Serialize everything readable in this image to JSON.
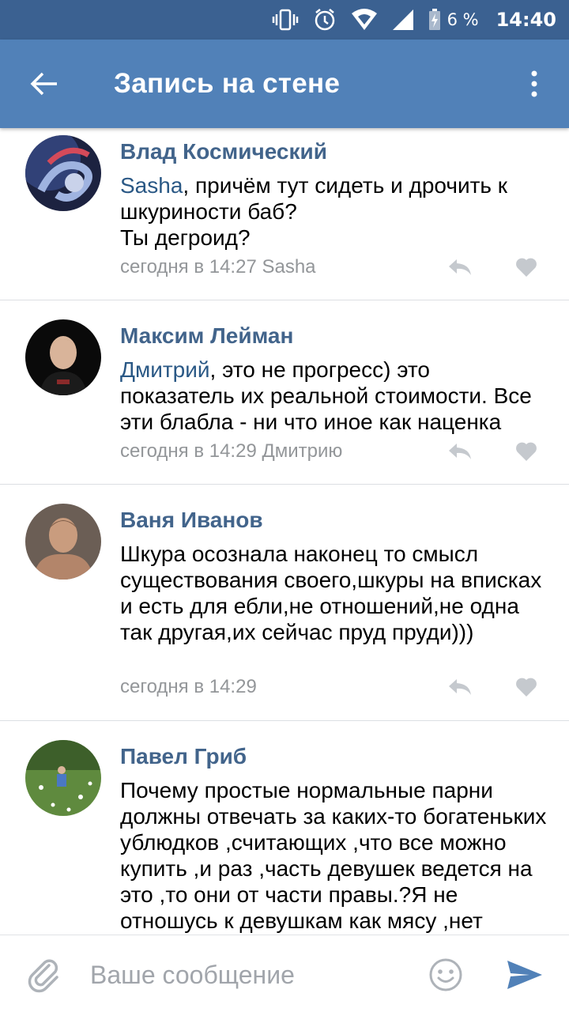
{
  "status_bar": {
    "battery_percent": "6 %",
    "time": "14:40"
  },
  "app_bar": {
    "title": "Запись на стене"
  },
  "comments": [
    {
      "author": "Влад Космический",
      "mention": "Sasha",
      "text_after_mention": ", причём тут сидеть и дрочить к шкуриности баб?\nТы дегроид?",
      "meta": "сегодня в 14:27 Sasha"
    },
    {
      "author": "Максим Лейман",
      "mention": "Дмитрий",
      "text_after_mention": ", это не прогресс) это показатель их реальной стоимости. Все эти блабла - ни что иное как наценка",
      "meta": "сегодня в 14:29 Дмитрию"
    },
    {
      "author": "Ваня Иванов",
      "text": "Шкура осознала наконец то смысл существования своего,шкуры на вписках и есть для ебли,не отношений,не одна так другая,их сейчас пруд пруди)))",
      "meta": "сегодня в 14:29"
    },
    {
      "author": "Павел Гриб",
      "text": "Почему простые нормальные парни должны отвечать за каких-то богатеньких  ублюдков ,считающих ,что все можно купить ,и раз ,часть девушек ведется на это ,то они от части правы.?Я не отношусь к девушкам как мясу ,нет",
      "meta": ""
    }
  ],
  "composer": {
    "placeholder": "Ваше сообщение"
  },
  "icons": {
    "back": "arrow-left-icon",
    "more": "more-vertical-icon",
    "reply": "reply-icon",
    "like": "heart-icon",
    "attach": "paperclip-icon",
    "emoji": "smiley-icon",
    "send": "send-icon"
  },
  "colors": {
    "status_bar": "#3b6191",
    "app_bar": "#5181b8",
    "author": "#42648b",
    "mention": "#2a5885",
    "meta": "#939699"
  }
}
